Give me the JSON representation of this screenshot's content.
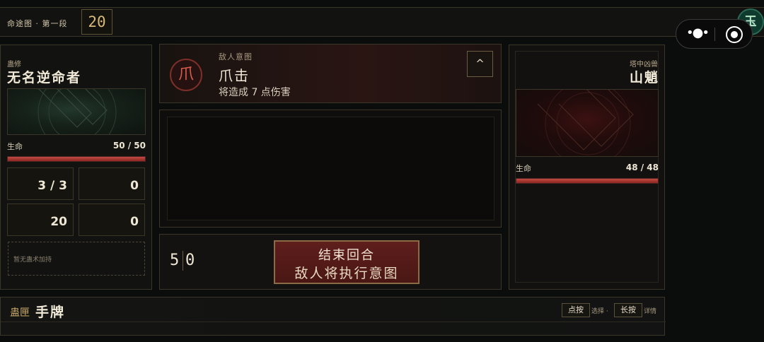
{
  "header": {
    "chapter": "命途图 · 第一段",
    "turn": "20",
    "jade": "玉"
  },
  "player": {
    "sect": "蛊修",
    "name": "无名逆命者",
    "hp_label": "生命",
    "hp_text": "50 / 50",
    "hp": 50,
    "hp_max": 50,
    "stats": [
      "3 / 3",
      "0",
      "20",
      "0"
    ],
    "buff_empty": "暂无蛊术加持"
  },
  "intent": {
    "label": "敌人意图",
    "icon_glyph": "爪",
    "title": "爪击",
    "description": "将造成 7 点伤害",
    "collapse_glyph": "^"
  },
  "actions": {
    "energy": "5",
    "energy_max": "0",
    "end_turn_title": "结束回合",
    "end_turn_sub": "敌人将执行意图"
  },
  "enemy": {
    "sect": "塔中凶兽",
    "name": "山魈",
    "hp_label": "生命",
    "hp_text": "48 / 48",
    "hp": 48,
    "hp_max": 48
  },
  "hand": {
    "prefix": "蛊匣",
    "title": "手牌",
    "hint_tap_key": "点按",
    "hint_tap_text": "选择 ·",
    "hint_hold_key": "长按",
    "hint_hold_text": "详情"
  },
  "colors": {
    "gold": "#d7b978",
    "health": "#c24a44",
    "end_button": "#5e1e1c",
    "jade": "#0f3a2e"
  }
}
